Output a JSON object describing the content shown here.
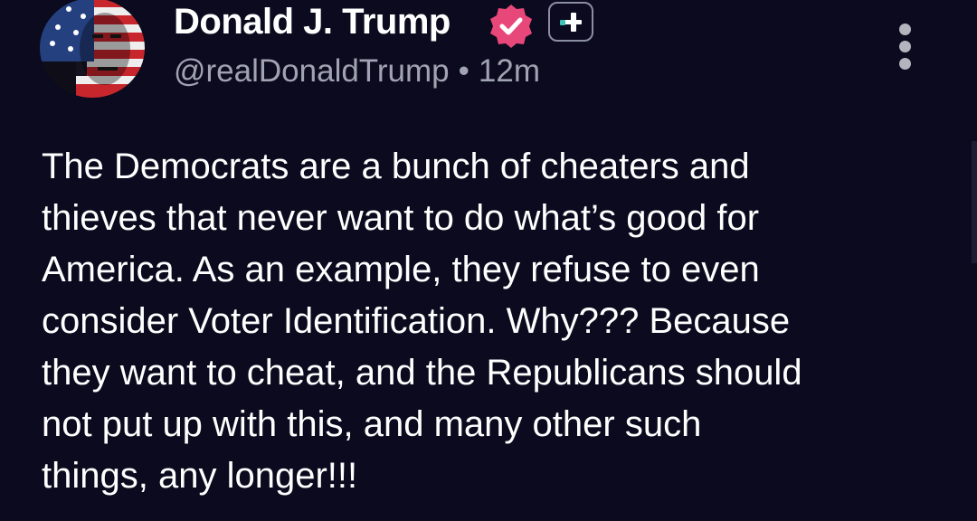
{
  "post": {
    "author": {
      "display_name": "Donald J. Trump",
      "handle": "@realDonaldTrump",
      "avatar_icon": "flag-painted-face-avatar",
      "verified_icon": "verified-badge-icon",
      "verified_color": "#e8477a",
      "subscription_icon": "plus-badge-icon"
    },
    "separator": "•",
    "timestamp": "12m",
    "more_icon": "vertical-ellipsis-icon",
    "text_lines": [
      "The Democrats are a bunch of cheaters and",
      "thieves that never want to do what’s good for",
      "America. As an example, they refuse to even",
      "consider Voter Identification. Why??? Because",
      "they want to cheat, and the Republicans should",
      "not put up with this, and many other such",
      "things, any longer!!!"
    ]
  },
  "colors": {
    "background": "#0b0a1e",
    "text": "#ffffff",
    "muted_text": "#a0a3b1",
    "accent_teal": "#3ec1b8"
  }
}
